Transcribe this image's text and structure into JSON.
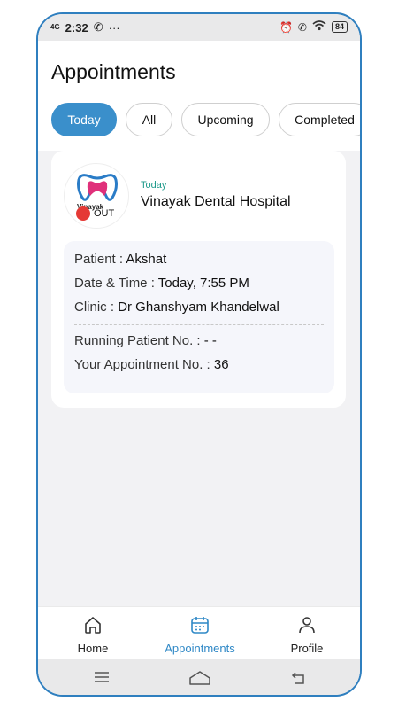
{
  "status_bar": {
    "network": "4G",
    "time": "2:32",
    "extra": "···",
    "battery": "84"
  },
  "header": {
    "title": "Appointments",
    "tabs": [
      {
        "label": "Today",
        "active": true
      },
      {
        "label": "All",
        "active": false
      },
      {
        "label": "Upcoming",
        "active": false
      },
      {
        "label": "Completed",
        "active": false
      }
    ]
  },
  "appointment": {
    "logo_text": "Vinayak",
    "status": "OUT",
    "date_label": "Today",
    "hospital": "Vinayak Dental Hospital",
    "patient_label": "Patient :",
    "patient": "Akshat",
    "datetime_label": "Date & Time :",
    "datetime": "Today, 7:55 PM",
    "clinic_label": "Clinic :",
    "clinic": "Dr Ghanshyam Khandelwal",
    "running_label": "Running Patient No. :",
    "running": "- -",
    "your_no_label": "Your Appointment No. :",
    "your_no": "36"
  },
  "bottom_nav": {
    "items": [
      {
        "label": "Home",
        "icon": "home-icon"
      },
      {
        "label": "Appointments",
        "icon": "calendar-icon"
      },
      {
        "label": "Profile",
        "icon": "profile-icon"
      }
    ],
    "active_color": "#2f88c6"
  },
  "colors": {
    "accent": "#3a8fcb",
    "status_out": "#e53935",
    "date_label": "#1f9a8b"
  }
}
